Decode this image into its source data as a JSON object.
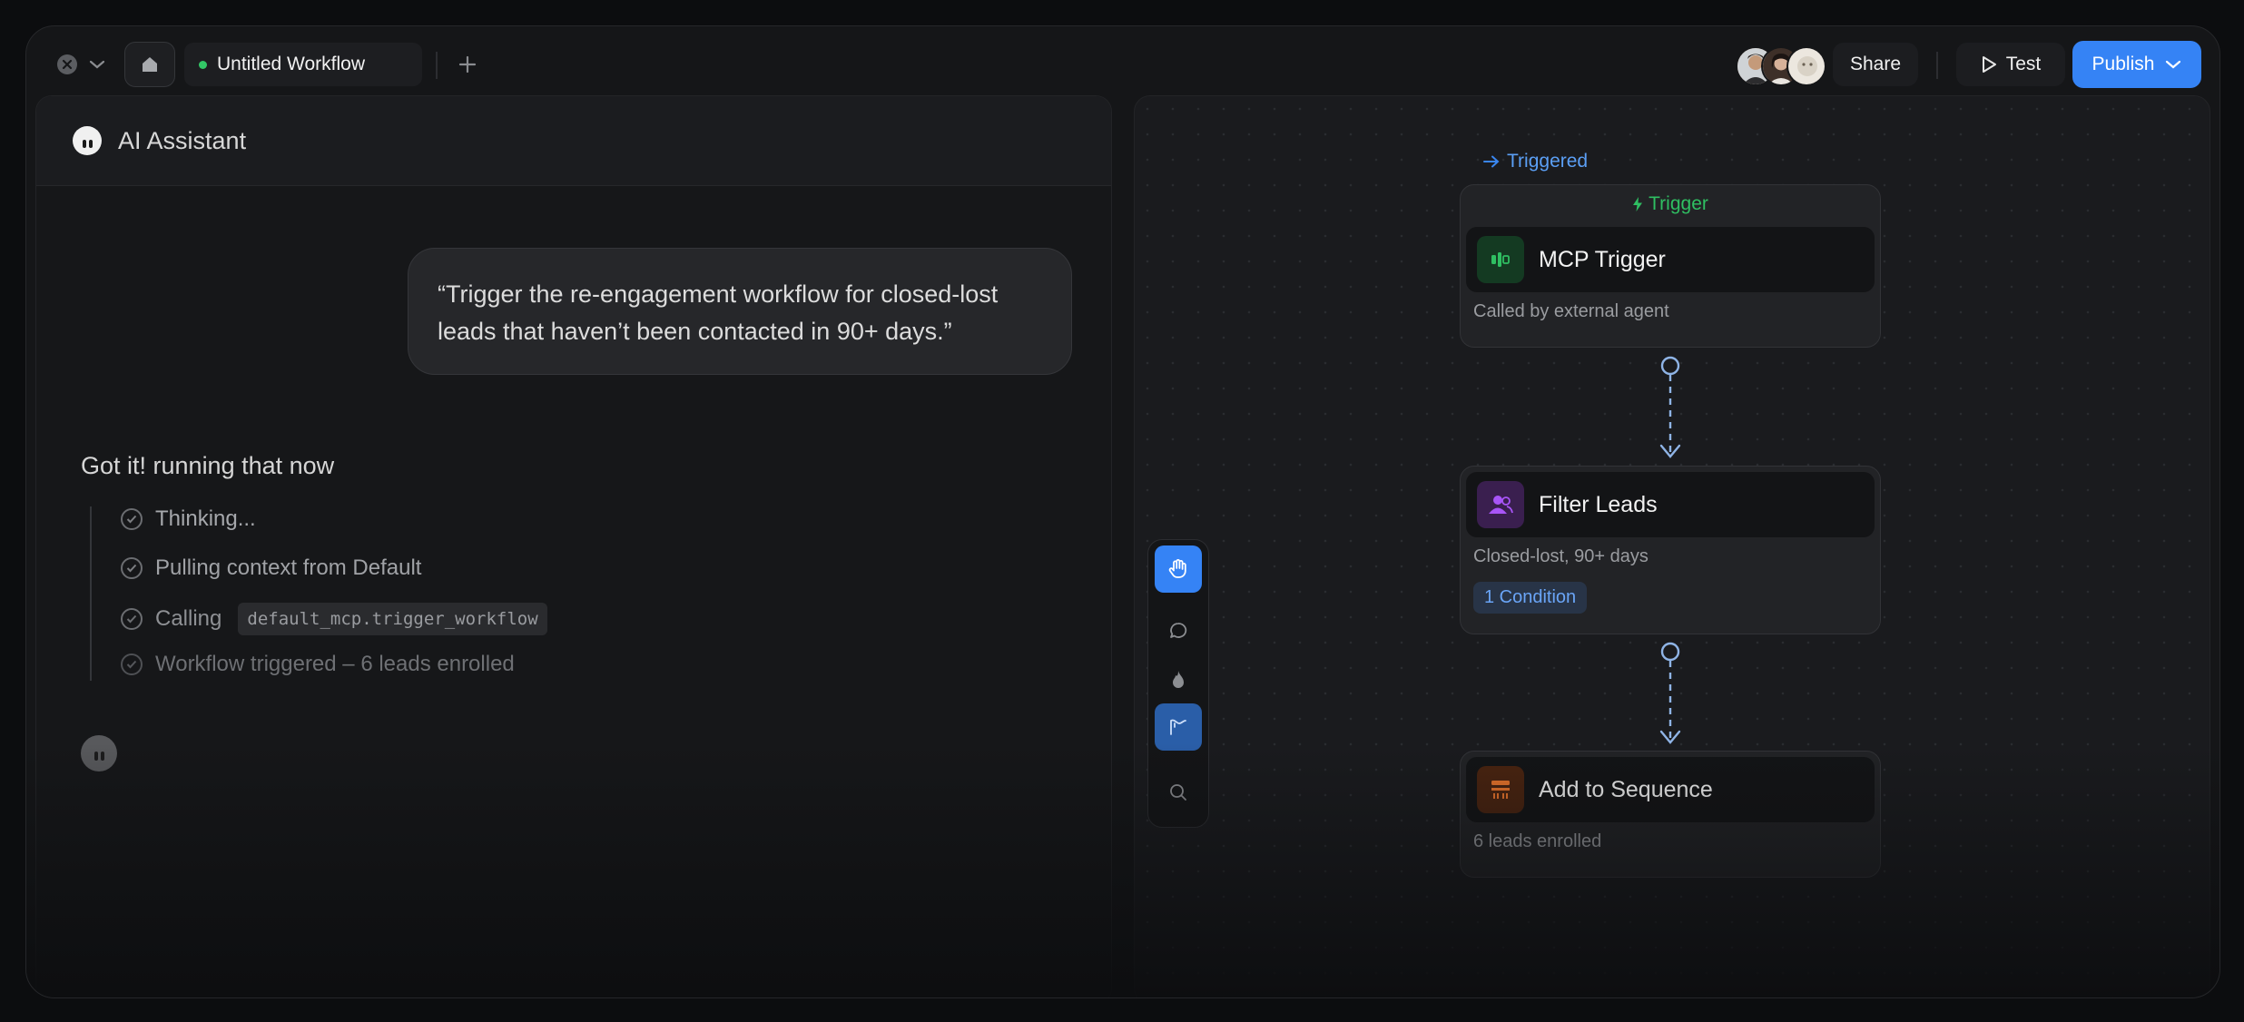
{
  "topbar": {
    "tab_title": "Untitled Workflow",
    "share_label": "Share",
    "test_label": "Test",
    "publish_label": "Publish"
  },
  "assistant": {
    "title": "AI Assistant",
    "user_message": "“Trigger the re-engagement workflow for closed-lost leads that haven’t been contacted in 90+ days.”",
    "response_heading": "Got it! running that now",
    "steps": [
      {
        "label": "Thinking..."
      },
      {
        "label": "Pulling context from Default"
      },
      {
        "label": "Calling",
        "code": "default_mcp.trigger_workflow"
      },
      {
        "label": "Workflow triggered – 6 leads enrolled"
      }
    ]
  },
  "workflow": {
    "status_label": "Triggered",
    "trigger_group_label": "Trigger",
    "nodes": [
      {
        "title": "MCP Trigger",
        "subtitle": "Called by external agent",
        "icon": "mcp-trigger-icon",
        "accent": "#2fbf62"
      },
      {
        "title": "Filter Leads",
        "subtitle": "Closed-lost, 90+ days",
        "badge": "1 Condition",
        "icon": "users-icon",
        "accent": "#a855f7"
      },
      {
        "title": "Add to Sequence",
        "subtitle": "6 leads enrolled",
        "icon": "sequence-icon",
        "accent": "#e8742b"
      }
    ]
  },
  "canvas_tools": [
    "hand-tool-icon",
    "comment-tool-icon",
    "fire-tool-icon",
    "path-tool-icon",
    "search-tool-icon"
  ],
  "colors": {
    "accent_blue": "#3583f5",
    "status_green": "#32c766",
    "filter_purple": "#a855f7",
    "sequence_orange": "#e8742b"
  }
}
